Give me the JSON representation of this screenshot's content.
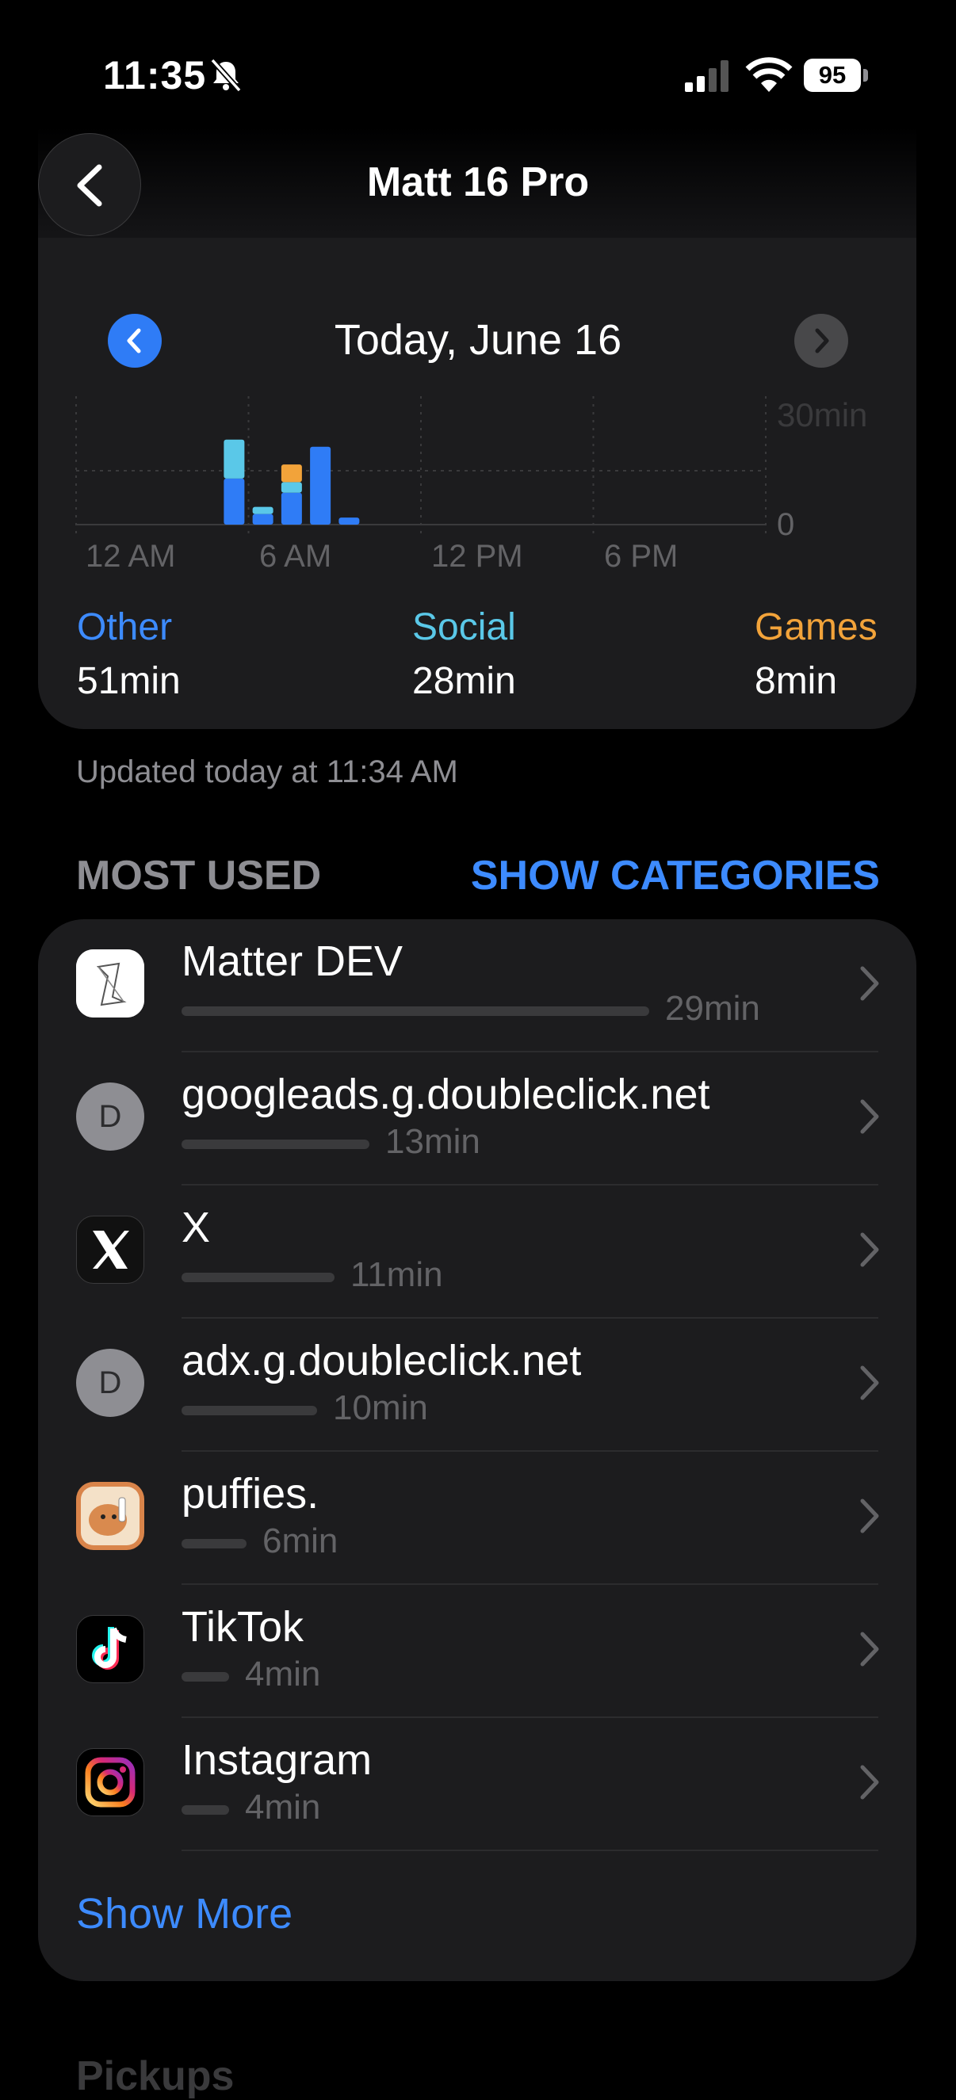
{
  "status_bar": {
    "time": "11:35",
    "battery": "95"
  },
  "header": {
    "title": "Matt 16 Pro"
  },
  "date_nav": {
    "label": "Today, June 16"
  },
  "chart_data": {
    "type": "bar",
    "stacked": true,
    "x_ticks": [
      "12 AM",
      "6 AM",
      "12 PM",
      "6 PM"
    ],
    "y_ticks": [
      "30min",
      "0"
    ],
    "ylim": [
      0,
      30
    ],
    "categories": [
      "5 AM",
      "6 AM",
      "7 AM",
      "8 AM",
      "9 AM"
    ],
    "series": [
      {
        "name": "Other",
        "color": "#2f7cf6",
        "values": [
          13,
          3,
          9,
          22,
          2
        ]
      },
      {
        "name": "Social",
        "color": "#5ac8e8",
        "values": [
          11,
          2,
          3,
          0,
          0
        ]
      },
      {
        "name": "Games",
        "color": "#f2a33a",
        "values": [
          0,
          0,
          5,
          0,
          0
        ]
      }
    ]
  },
  "categories": [
    {
      "name": "Other",
      "value": "51min",
      "color": "#3d8bff"
    },
    {
      "name": "Social",
      "value": "28min",
      "color": "#5ac8e8"
    },
    {
      "name": "Games",
      "value": "8min",
      "color": "#f2a33a"
    }
  ],
  "updated": "Updated today at 11:34 AM",
  "most_used": {
    "title": "MOST USED",
    "toggle": "SHOW CATEGORIES",
    "apps": [
      {
        "name": "Matter DEV",
        "time": "29min",
        "icon": "matter-dev-icon",
        "minutes": 29
      },
      {
        "name": "googleads.g.doubleclick.net",
        "time": "13min",
        "icon": "letter-d-icon",
        "letter": "D",
        "minutes": 13
      },
      {
        "name": "X",
        "time": "11min",
        "icon": "x-app-icon",
        "minutes": 11
      },
      {
        "name": "adx.g.doubleclick.net",
        "time": "10min",
        "icon": "letter-d-icon",
        "letter": "D",
        "minutes": 10
      },
      {
        "name": "puffies.",
        "time": "6min",
        "icon": "puffies-icon",
        "minutes": 6
      },
      {
        "name": "TikTok",
        "time": "4min",
        "icon": "tiktok-icon",
        "minutes": 4
      },
      {
        "name": "Instagram",
        "time": "4min",
        "icon": "instagram-icon",
        "minutes": 4
      }
    ],
    "show_more": "Show More"
  },
  "next_section": "Pickups"
}
